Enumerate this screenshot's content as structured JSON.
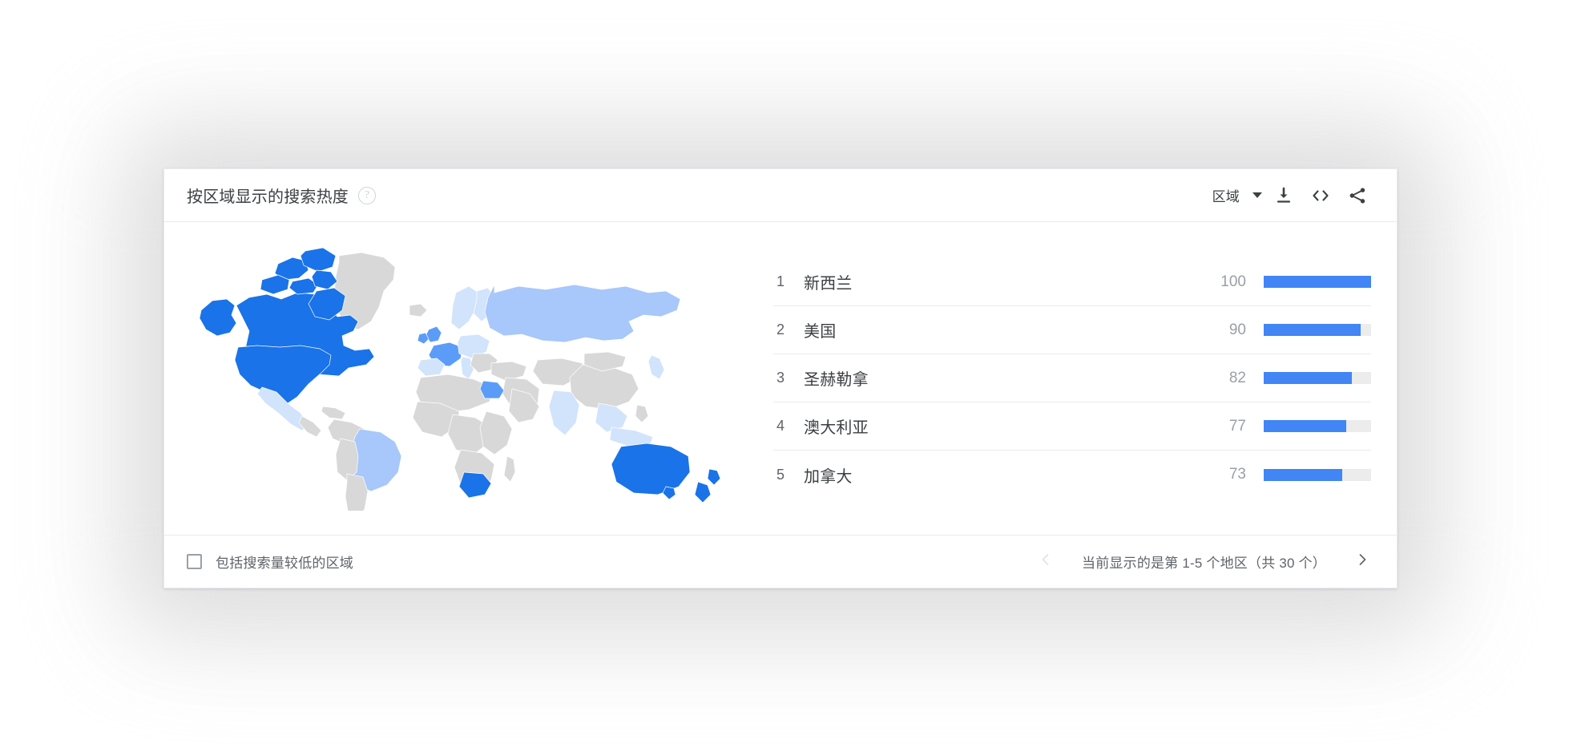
{
  "panel": {
    "title": "按区域显示的搜索热度",
    "help_icon": "?",
    "region_selector": {
      "label": "区域",
      "caret_icon": "chevron-down-icon"
    },
    "actions": [
      {
        "name": "download-icon",
        "tooltip": ""
      },
      {
        "name": "embed-code-icon",
        "tooltip": ""
      },
      {
        "name": "share-icon",
        "tooltip": ""
      }
    ]
  },
  "footer": {
    "checkbox_label": "包括搜索量较低的区域",
    "checkbox_checked": false,
    "pager_text": "当前显示的是第 1-5 个地区（共 30 个）",
    "prev_icon": "chevron-left-icon",
    "next_icon": "chevron-right-icon",
    "prev_enabled": false,
    "next_enabled": true
  },
  "colors": {
    "bar_fill": "#4285f4",
    "bar_track": "#ececec",
    "map_high": "#1a73e8",
    "map_mid": "#5b9cf8",
    "map_low": "#a8c7fa",
    "map_faint": "#d2e3fc",
    "map_none": "#d8d8d8",
    "text_primary": "#3c4043",
    "text_secondary": "#5f6368",
    "text_muted": "#9aa0a6"
  },
  "chart_data": {
    "type": "bar",
    "title": "按区域显示的搜索热度",
    "xlabel": "",
    "ylabel": "",
    "ylim": [
      0,
      100
    ],
    "orientation": "horizontal",
    "grid": false,
    "legend": null,
    "categories": [
      "新西兰",
      "美国",
      "圣赫勒拿",
      "澳大利亚",
      "加拿大"
    ],
    "values": [
      100,
      90,
      82,
      77,
      73
    ],
    "rows": [
      {
        "rank": "1",
        "name": "新西兰",
        "value": "100",
        "pct": 100
      },
      {
        "rank": "2",
        "name": "美国",
        "value": "90",
        "pct": 90
      },
      {
        "rank": "3",
        "name": "圣赫勒拿",
        "value": "82",
        "pct": 82
      },
      {
        "rank": "4",
        "name": "澳大利亚",
        "value": "77",
        "pct": 77
      },
      {
        "rank": "5",
        "name": "加拿大",
        "value": "73",
        "pct": 73
      }
    ],
    "total_regions": "30",
    "showing_range": "1-5"
  }
}
